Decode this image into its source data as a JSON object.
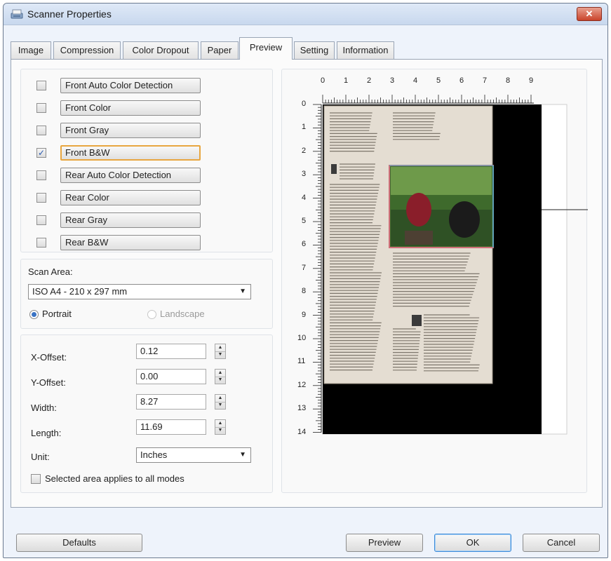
{
  "window": {
    "title": "Scanner Properties",
    "close_label": "✕"
  },
  "tabs": [
    {
      "label": "Image",
      "active": false
    },
    {
      "label": "Compression",
      "active": false
    },
    {
      "label": "Color Dropout",
      "active": false
    },
    {
      "label": "Paper",
      "active": false
    },
    {
      "label": "Preview",
      "active": true
    },
    {
      "label": "Setting",
      "active": false
    },
    {
      "label": "Information",
      "active": false
    }
  ],
  "image_modes": [
    {
      "label": "Front Auto Color Detection",
      "checked": false
    },
    {
      "label": "Front Color",
      "checked": false
    },
    {
      "label": "Front Gray",
      "checked": false
    },
    {
      "label": "Front B&W",
      "checked": true,
      "check_mark": "✓"
    },
    {
      "label": "Rear Auto Color Detection",
      "checked": false
    },
    {
      "label": "Rear Color",
      "checked": false
    },
    {
      "label": "Rear Gray",
      "checked": false
    },
    {
      "label": "Rear B&W",
      "checked": false
    }
  ],
  "scan_area": {
    "label": "Scan Area:",
    "selected": "ISO A4 - 210 x 297 mm",
    "orientation": {
      "portrait": "Portrait",
      "landscape": "Landscape",
      "selected": "portrait"
    }
  },
  "dimensions": {
    "x_offset": {
      "label": "X-Offset:",
      "value": "0.12"
    },
    "y_offset": {
      "label": "Y-Offset:",
      "value": "0.00"
    },
    "width": {
      "label": "Width:",
      "value": "8.27"
    },
    "length": {
      "label": "Length:",
      "value": "11.69"
    },
    "unit": {
      "label": "Unit:",
      "selected": "Inches"
    },
    "apply_all": {
      "label": "Selected area applies to all modes",
      "checked": false
    }
  },
  "preview": {
    "ruler_x": [
      "0",
      "1",
      "2",
      "3",
      "4",
      "5",
      "6",
      "7",
      "8",
      "9"
    ],
    "ruler_y": [
      "0",
      "1",
      "2",
      "3",
      "4",
      "5",
      "6",
      "7",
      "8",
      "9",
      "10",
      "11",
      "12",
      "13",
      "14"
    ]
  },
  "buttons": {
    "defaults": "Defaults",
    "preview": "Preview",
    "ok": "OK",
    "cancel": "Cancel"
  },
  "colors": {
    "accent_focus": "#e8a640",
    "ok_border": "#3c8ad8",
    "close_red": "#c9432b"
  }
}
